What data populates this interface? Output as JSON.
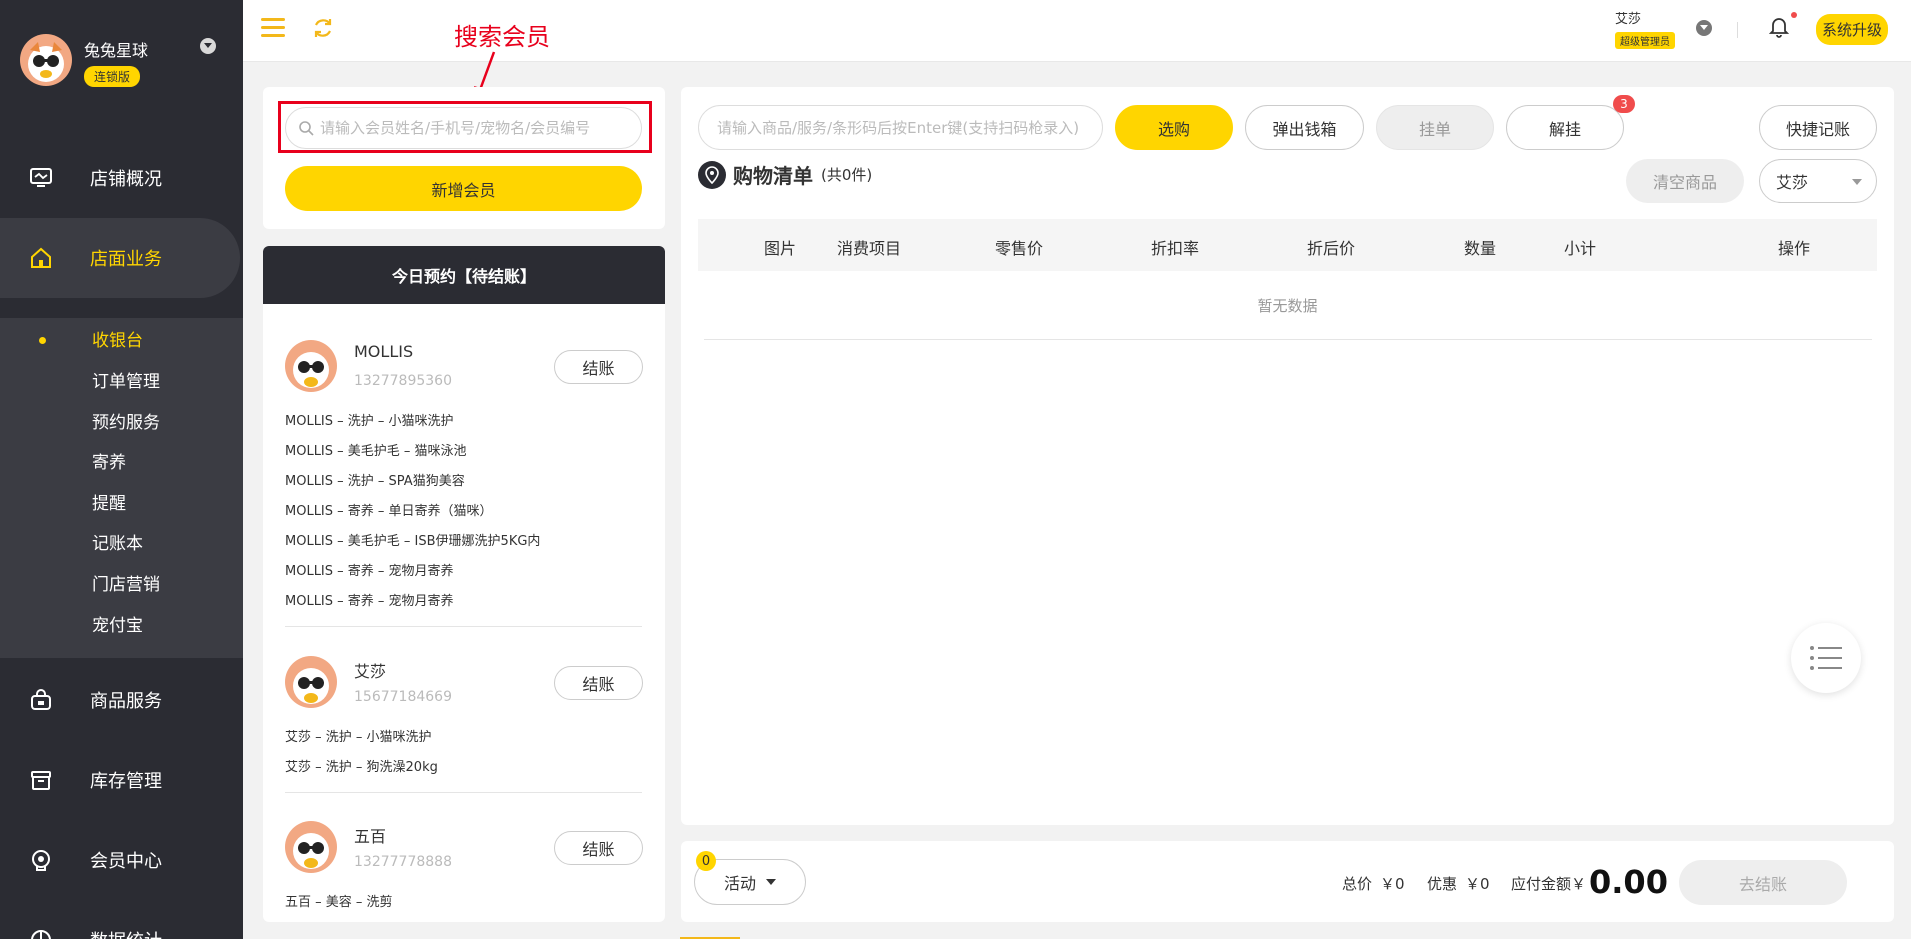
{
  "sidebar": {
    "store_name": "兔兔星球",
    "edition_badge": "连锁版",
    "nav": [
      {
        "label": "店铺概况",
        "icon": "monitor-icon"
      },
      {
        "label": "店面业务",
        "icon": "home-icon"
      },
      {
        "label": "商品服务",
        "icon": "bag-icon"
      },
      {
        "label": "库存管理",
        "icon": "box-icon"
      },
      {
        "label": "会员中心",
        "icon": "member-icon"
      },
      {
        "label": "数据统计",
        "icon": "chart-icon"
      }
    ],
    "sub_items": [
      "收银台",
      "订单管理",
      "预约服务",
      "寄养",
      "提醒",
      "记账本",
      "门店营销",
      "宠付宝"
    ]
  },
  "topbar": {
    "user_name": "艾莎",
    "user_role": "超级管理员",
    "upgrade_label": "系统升级"
  },
  "annotation": {
    "label": "搜索会员"
  },
  "member": {
    "search_placeholder": "请输入会员姓名/手机号/宠物名/会员编号",
    "add_button": "新增会员"
  },
  "appointments": {
    "title": "今日预约【待结账】",
    "pay_label": "结账",
    "items": [
      {
        "name": "MOLLIS",
        "phone": "13277895360",
        "lines": [
          "MOLLIS – 洗护 – 小猫咪洗护",
          "MOLLIS – 美毛护毛 – 猫咪泳池",
          "MOLLIS – 洗护 – SPA猫狗美容",
          "MOLLIS – 寄养 – 单日寄养（猫咪）",
          "MOLLIS – 美毛护毛 – ISB伊珊娜洗护5KG内",
          "MOLLIS – 寄养 – 宠物月寄养",
          "MOLLIS – 寄养 – 宠物月寄养"
        ]
      },
      {
        "name": "艾莎",
        "phone": "15677184669",
        "lines": [
          "艾莎 – 洗护 – 小猫咪洗护",
          "艾莎 – 洗护 – 狗洗澡20kg"
        ]
      },
      {
        "name": "五百",
        "phone": "13277778888",
        "lines": [
          "五百 – 美容 – 洗剪"
        ]
      }
    ]
  },
  "cart": {
    "product_search_placeholder": "请输入商品/服务/条形码后按Enter键(支持扫码枪录入)",
    "buttons": {
      "select": "选购",
      "cash_drawer": "弹出钱箱",
      "hold": "挂单",
      "unhold": "解挂",
      "quick_note": "快捷记账"
    },
    "unhold_count": "3",
    "list_title": "购物清单",
    "list_count": "(共0件)",
    "clear_label": "清空商品",
    "staff_selected": "艾莎",
    "columns": [
      "图片",
      "消费项目",
      "零售价",
      "折扣率",
      "折后价",
      "数量",
      "小计",
      "操作"
    ],
    "empty_text": "暂无数据"
  },
  "footer": {
    "promo_count": "0",
    "promo_label": "活动",
    "total_label": "总价",
    "total_value": "￥0",
    "discount_label": "优惠",
    "discount_value": "￥0",
    "due_label": "应付金额￥",
    "due_value": "0.00",
    "checkout_label": "去结账"
  },
  "colors": {
    "accent": "#ffd500",
    "sidebar_bg": "#2b2c33",
    "annotation": "#e8001c"
  }
}
